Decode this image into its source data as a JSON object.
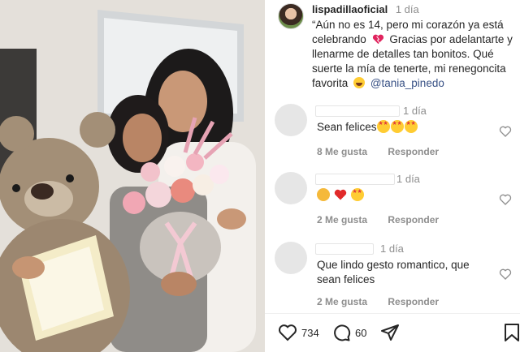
{
  "post": {
    "username": "lispadillaoficial",
    "time": "1 día",
    "caption_part1": "“Aún no es 14, pero mi corazón ya está celebrando",
    "caption_part2": "Gracias por adelantarte y llenarme de detalles tan bonitos. Qué suerte la mía de tenerte, mi renegoncita favorita",
    "mention": "@tania_pinedo"
  },
  "comments": [
    {
      "time": "1 día",
      "text": "Sean felices",
      "emojis": [
        "star-eyes",
        "star-eyes",
        "star-eyes"
      ],
      "likes": "8 Me gusta",
      "reply": "Responder"
    },
    {
      "time": "1 día",
      "text": "",
      "emojis": [
        "clap",
        "heart",
        "star-eyes"
      ],
      "likes": "2 Me gusta",
      "reply": "Responder"
    },
    {
      "time": "1 día",
      "text": "Que lindo gesto romantico, que sean felices",
      "emojis": [],
      "likes": "2 Me gusta",
      "reply": "Responder"
    }
  ],
  "actions": {
    "like_count": "734",
    "comment_count": "60"
  },
  "colors": {
    "text": "#262626",
    "muted": "#8e8e8e",
    "mention": "#385185",
    "heart": "#e0245e"
  }
}
